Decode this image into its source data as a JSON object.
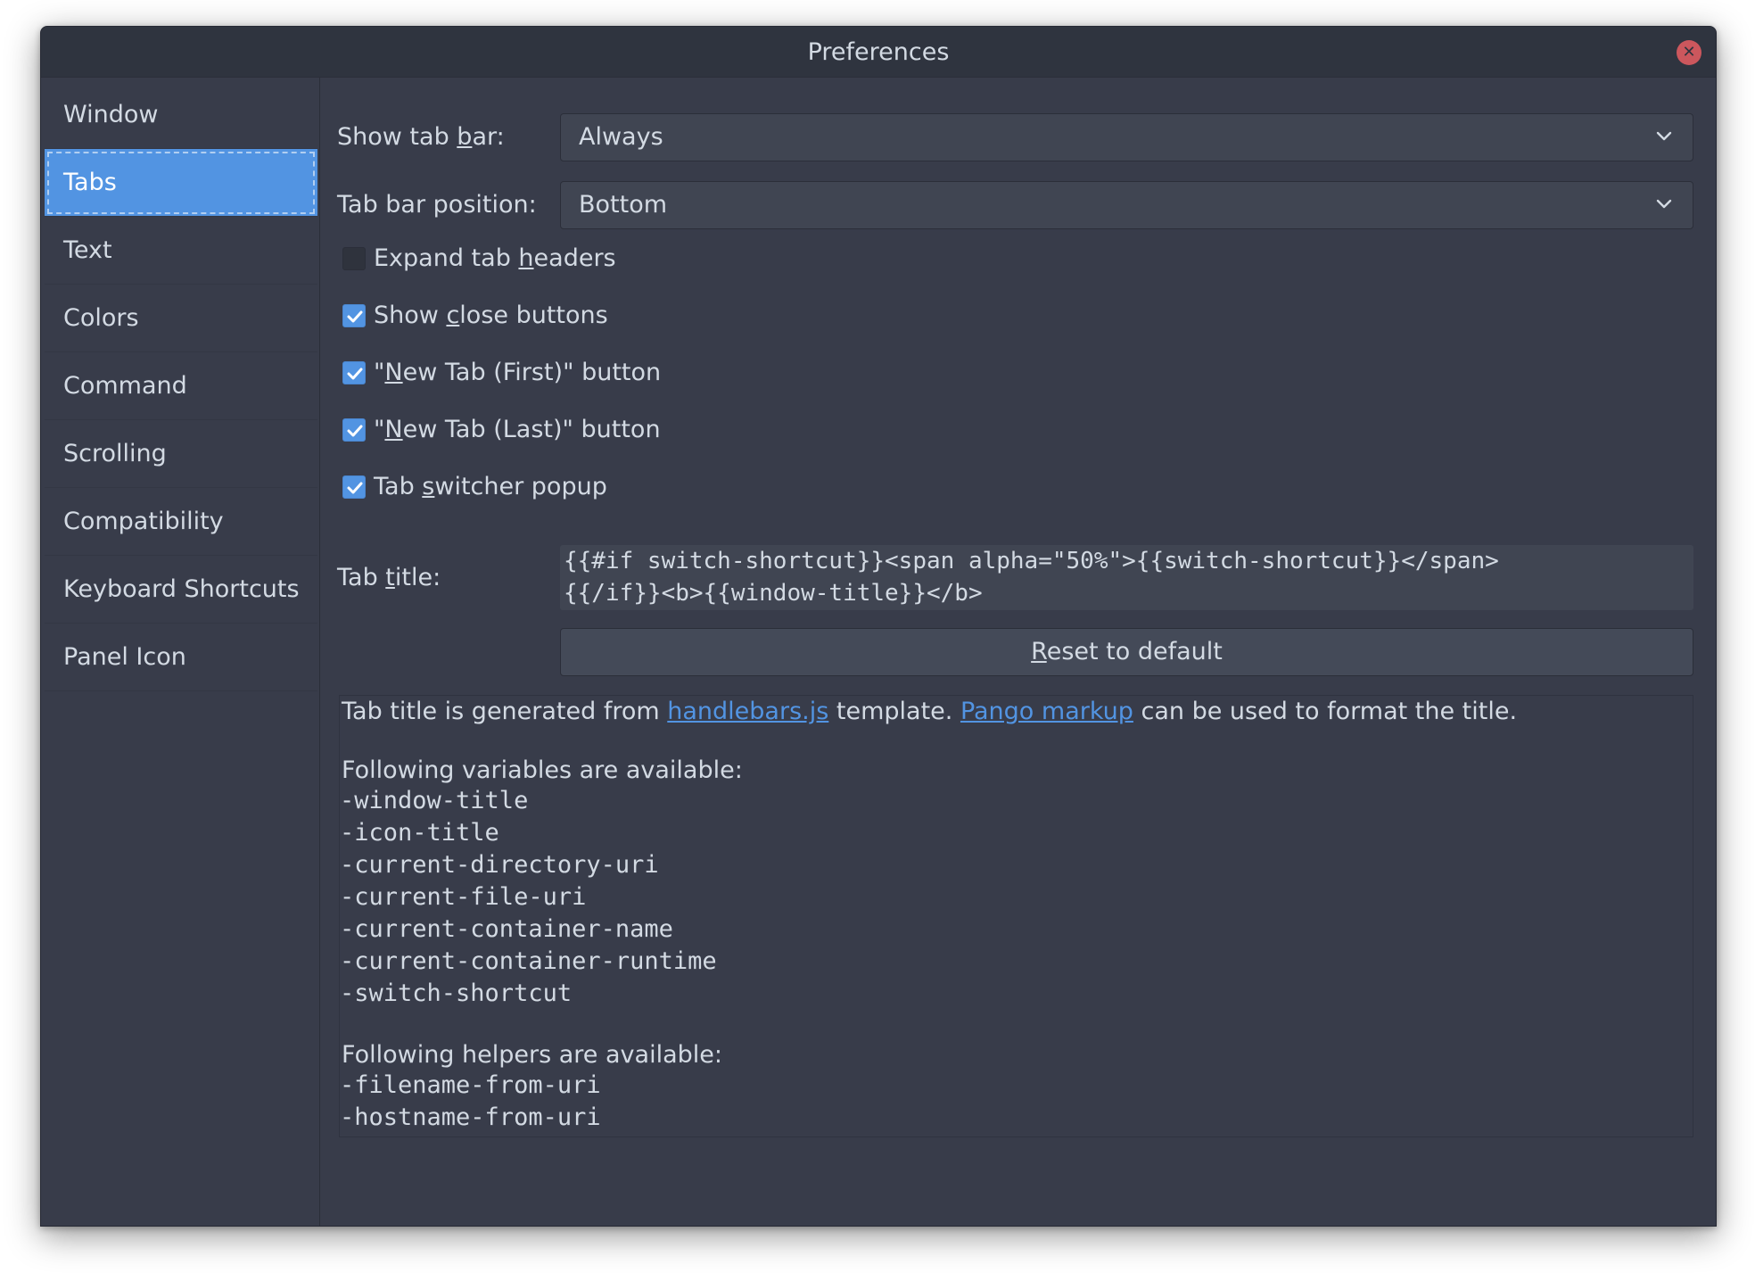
{
  "window": {
    "title": "Preferences"
  },
  "sidebar": {
    "items": [
      {
        "label": "Window",
        "active": false
      },
      {
        "label": "Tabs",
        "active": true
      },
      {
        "label": "Text",
        "active": false
      },
      {
        "label": "Colors",
        "active": false
      },
      {
        "label": "Command",
        "active": false
      },
      {
        "label": "Scrolling",
        "active": false
      },
      {
        "label": "Compatibility",
        "active": false
      },
      {
        "label": "Keyboard Shortcuts",
        "active": false
      },
      {
        "label": "Panel Icon",
        "active": false
      }
    ]
  },
  "tabs_page": {
    "show_tab_bar": {
      "label_pre": "Show tab ",
      "label_mnemonic": "b",
      "label_post": "ar:",
      "value": "Always"
    },
    "tab_bar_position": {
      "label": "Tab bar position:",
      "value": "Bottom"
    },
    "checkboxes": [
      {
        "pre": "Expand tab ",
        "mnemonic": "h",
        "post": "eaders",
        "checked": false
      },
      {
        "pre": "Show ",
        "mnemonic": "c",
        "post": "lose buttons",
        "checked": true
      },
      {
        "pre": "\"",
        "mnemonic": "N",
        "post": "ew Tab (First)\" button",
        "checked": true
      },
      {
        "pre": "\"",
        "mnemonic": "N",
        "post": "ew Tab (Last)\" button",
        "checked": true
      },
      {
        "pre": "Tab ",
        "mnemonic": "s",
        "post": "witcher popup",
        "checked": true
      }
    ],
    "tab_title": {
      "label_pre": "Tab ",
      "label_mnemonic": "t",
      "label_post": "itle:",
      "line1": "{{#if switch-shortcut}}<span alpha=\"50%\">{{switch-shortcut}}</span>",
      "line2": "{{/if}}<b>{{window-title}}</b>"
    },
    "reset_button": {
      "mnemonic": "R",
      "rest": "eset to default"
    },
    "help": {
      "intro_pre": "Tab title is generated from ",
      "link1": "handlebars.js",
      "intro_mid": " template. ",
      "link2": "Pango markup",
      "intro_post": " can be used to format the title.",
      "variables_heading": "Following variables are available:",
      "variables": [
        "-window-title",
        "-icon-title",
        "-current-directory-uri",
        "-current-file-uri",
        "-current-container-name",
        "-current-container-runtime",
        "-switch-shortcut"
      ],
      "helpers_heading": "Following helpers are available:",
      "helpers": [
        "-filename-from-uri",
        "-hostname-from-uri"
      ]
    }
  },
  "colors": {
    "accent": "#5294e2",
    "background": "#383c4a",
    "titlebar": "#2f343f",
    "text": "#d3dae3",
    "close_button": "#cc575d"
  },
  "icons": {
    "close": "close-icon",
    "dropdown": "chevron-down-icon",
    "check": "checkmark-icon"
  }
}
